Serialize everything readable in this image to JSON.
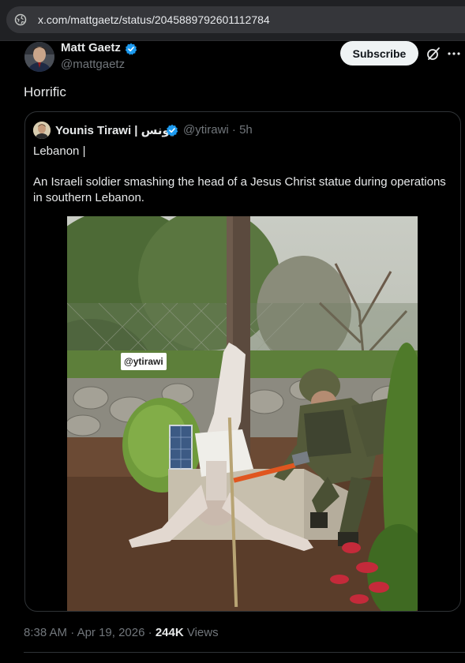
{
  "browser": {
    "url": "x.com/mattgaetz/status/2045889792601112784",
    "site_icon": "site-info-icon"
  },
  "author": {
    "name": "Matt Gaetz",
    "handle": "@mattgaetz",
    "verified": true
  },
  "actions": {
    "subscribe_label": "Subscribe",
    "grok_icon": "grok-icon",
    "more_icon": "more-icon"
  },
  "tweet": {
    "text": "Horrific"
  },
  "quote": {
    "name": "Younis Tirawi | يونس",
    "handle": "@ytirawi",
    "time": "5h",
    "separator": "·",
    "line1": "Lebanon |",
    "body": "An Israeli soldier smashing the head of a Jesus Christ statue during operations in southern Lebanon.",
    "image_watermark": "@ytirawi"
  },
  "meta": {
    "time": "8:38 AM",
    "date": "Apr 19, 2026",
    "views_count": "244K",
    "views_label": "Views",
    "separator": "·"
  },
  "colors": {
    "background": "#000000",
    "text": "#e7e9ea",
    "muted": "#71767b",
    "verified": "#1d9bf0",
    "border": "#2f3336"
  }
}
